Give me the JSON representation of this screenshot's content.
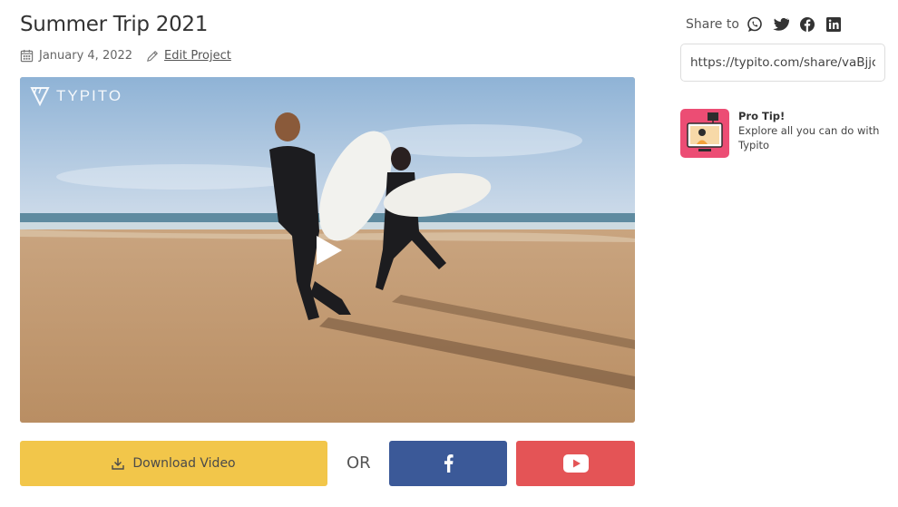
{
  "project": {
    "title": "Summer Trip 2021",
    "date": "January 4, 2022",
    "edit_label": "Edit Project"
  },
  "video": {
    "brand": "TYPITO"
  },
  "actions": {
    "download_label": "Download Video",
    "or_label": "OR"
  },
  "share": {
    "label": "Share to",
    "icons": [
      "whatsapp-icon",
      "twitter-icon",
      "facebook-icon",
      "linkedin-icon"
    ],
    "url": "https://typito.com/share/vaBjjc"
  },
  "tip": {
    "heading": "Pro Tip!",
    "body": "Explore all you can do with Typito"
  },
  "colors": {
    "download": "#f2c64a",
    "facebook": "#3b5998",
    "youtube": "#e45456",
    "tip_thumb": "#ec4d74"
  }
}
